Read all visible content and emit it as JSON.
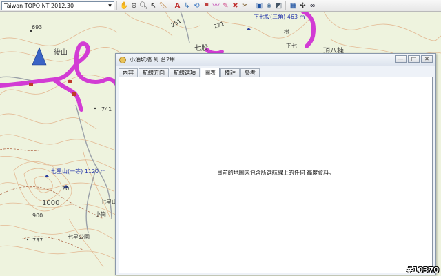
{
  "toolbar": {
    "map_product": "Taiwan TOPO NT 2012.30",
    "icons": [
      "hand-icon",
      "zoom-icon",
      "magnify-icon",
      "select-arrow-icon",
      "measure-icon",
      "text-icon",
      "route-icon",
      "connect-icon",
      "point-icon",
      "track-icon",
      "edit-icon",
      "erase-icon",
      "split-icon",
      "map-view-icon",
      "3d-view-icon",
      "layers-icon",
      "grid-icon",
      "compass-icon",
      "binoculars-icon"
    ]
  },
  "map": {
    "labels": {
      "peak_693": "693",
      "peak_741": "741",
      "hou_shan": "後山",
      "lower_qishe": "下七股(三角)  463 m",
      "lower_qi": "下七",
      "qigu": "七股",
      "upper_bagen": "頂八棟",
      "a251": "251",
      "a271": "271",
      "qixing": "七星山(一等)  1120 m",
      "elev_1000": "1000",
      "elev_900": "900",
      "elev_737": "737",
      "qixing_park": "七星公園",
      "dist_20": "20",
      "xiaogang": "小崗",
      "qixing_road": "七星山",
      "shu": "樹"
    },
    "colors": {
      "background": "#eef3de",
      "contour": "#e2b48e",
      "track": "#d23cd4",
      "road": "#9aa0a8"
    }
  },
  "dialog": {
    "title": "小油坑橋 到 台2甲",
    "tabs": [
      "內容",
      "航線方向",
      "航線選項",
      "圖表",
      "備註",
      "參考"
    ],
    "active_tab": "圖表",
    "message": "目前的地圖未包含所選航線上的任何 高度資料。",
    "window_buttons": {
      "minimize": "—",
      "maximize": "□",
      "close": "✕"
    }
  },
  "watermark": "#10370"
}
